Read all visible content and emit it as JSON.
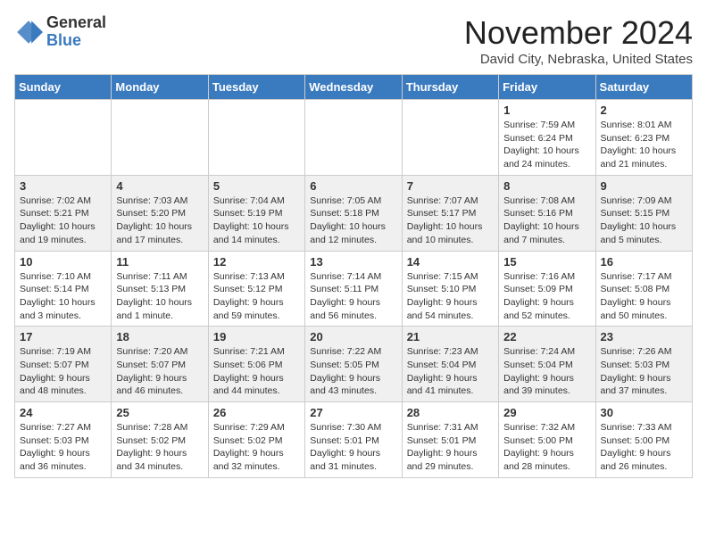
{
  "header": {
    "logo_general": "General",
    "logo_blue": "Blue",
    "month_title": "November 2024",
    "location": "David City, Nebraska, United States"
  },
  "weekdays": [
    "Sunday",
    "Monday",
    "Tuesday",
    "Wednesday",
    "Thursday",
    "Friday",
    "Saturday"
  ],
  "weeks": [
    [
      {
        "day": "",
        "info": ""
      },
      {
        "day": "",
        "info": ""
      },
      {
        "day": "",
        "info": ""
      },
      {
        "day": "",
        "info": ""
      },
      {
        "day": "",
        "info": ""
      },
      {
        "day": "1",
        "info": "Sunrise: 7:59 AM\nSunset: 6:24 PM\nDaylight: 10 hours\nand 24 minutes."
      },
      {
        "day": "2",
        "info": "Sunrise: 8:01 AM\nSunset: 6:23 PM\nDaylight: 10 hours\nand 21 minutes."
      }
    ],
    [
      {
        "day": "3",
        "info": "Sunrise: 7:02 AM\nSunset: 5:21 PM\nDaylight: 10 hours\nand 19 minutes."
      },
      {
        "day": "4",
        "info": "Sunrise: 7:03 AM\nSunset: 5:20 PM\nDaylight: 10 hours\nand 17 minutes."
      },
      {
        "day": "5",
        "info": "Sunrise: 7:04 AM\nSunset: 5:19 PM\nDaylight: 10 hours\nand 14 minutes."
      },
      {
        "day": "6",
        "info": "Sunrise: 7:05 AM\nSunset: 5:18 PM\nDaylight: 10 hours\nand 12 minutes."
      },
      {
        "day": "7",
        "info": "Sunrise: 7:07 AM\nSunset: 5:17 PM\nDaylight: 10 hours\nand 10 minutes."
      },
      {
        "day": "8",
        "info": "Sunrise: 7:08 AM\nSunset: 5:16 PM\nDaylight: 10 hours\nand 7 minutes."
      },
      {
        "day": "9",
        "info": "Sunrise: 7:09 AM\nSunset: 5:15 PM\nDaylight: 10 hours\nand 5 minutes."
      }
    ],
    [
      {
        "day": "10",
        "info": "Sunrise: 7:10 AM\nSunset: 5:14 PM\nDaylight: 10 hours\nand 3 minutes."
      },
      {
        "day": "11",
        "info": "Sunrise: 7:11 AM\nSunset: 5:13 PM\nDaylight: 10 hours\nand 1 minute."
      },
      {
        "day": "12",
        "info": "Sunrise: 7:13 AM\nSunset: 5:12 PM\nDaylight: 9 hours\nand 59 minutes."
      },
      {
        "day": "13",
        "info": "Sunrise: 7:14 AM\nSunset: 5:11 PM\nDaylight: 9 hours\nand 56 minutes."
      },
      {
        "day": "14",
        "info": "Sunrise: 7:15 AM\nSunset: 5:10 PM\nDaylight: 9 hours\nand 54 minutes."
      },
      {
        "day": "15",
        "info": "Sunrise: 7:16 AM\nSunset: 5:09 PM\nDaylight: 9 hours\nand 52 minutes."
      },
      {
        "day": "16",
        "info": "Sunrise: 7:17 AM\nSunset: 5:08 PM\nDaylight: 9 hours\nand 50 minutes."
      }
    ],
    [
      {
        "day": "17",
        "info": "Sunrise: 7:19 AM\nSunset: 5:07 PM\nDaylight: 9 hours\nand 48 minutes."
      },
      {
        "day": "18",
        "info": "Sunrise: 7:20 AM\nSunset: 5:07 PM\nDaylight: 9 hours\nand 46 minutes."
      },
      {
        "day": "19",
        "info": "Sunrise: 7:21 AM\nSunset: 5:06 PM\nDaylight: 9 hours\nand 44 minutes."
      },
      {
        "day": "20",
        "info": "Sunrise: 7:22 AM\nSunset: 5:05 PM\nDaylight: 9 hours\nand 43 minutes."
      },
      {
        "day": "21",
        "info": "Sunrise: 7:23 AM\nSunset: 5:04 PM\nDaylight: 9 hours\nand 41 minutes."
      },
      {
        "day": "22",
        "info": "Sunrise: 7:24 AM\nSunset: 5:04 PM\nDaylight: 9 hours\nand 39 minutes."
      },
      {
        "day": "23",
        "info": "Sunrise: 7:26 AM\nSunset: 5:03 PM\nDaylight: 9 hours\nand 37 minutes."
      }
    ],
    [
      {
        "day": "24",
        "info": "Sunrise: 7:27 AM\nSunset: 5:03 PM\nDaylight: 9 hours\nand 36 minutes."
      },
      {
        "day": "25",
        "info": "Sunrise: 7:28 AM\nSunset: 5:02 PM\nDaylight: 9 hours\nand 34 minutes."
      },
      {
        "day": "26",
        "info": "Sunrise: 7:29 AM\nSunset: 5:02 PM\nDaylight: 9 hours\nand 32 minutes."
      },
      {
        "day": "27",
        "info": "Sunrise: 7:30 AM\nSunset: 5:01 PM\nDaylight: 9 hours\nand 31 minutes."
      },
      {
        "day": "28",
        "info": "Sunrise: 7:31 AM\nSunset: 5:01 PM\nDaylight: 9 hours\nand 29 minutes."
      },
      {
        "day": "29",
        "info": "Sunrise: 7:32 AM\nSunset: 5:00 PM\nDaylight: 9 hours\nand 28 minutes."
      },
      {
        "day": "30",
        "info": "Sunrise: 7:33 AM\nSunset: 5:00 PM\nDaylight: 9 hours\nand 26 minutes."
      }
    ]
  ]
}
